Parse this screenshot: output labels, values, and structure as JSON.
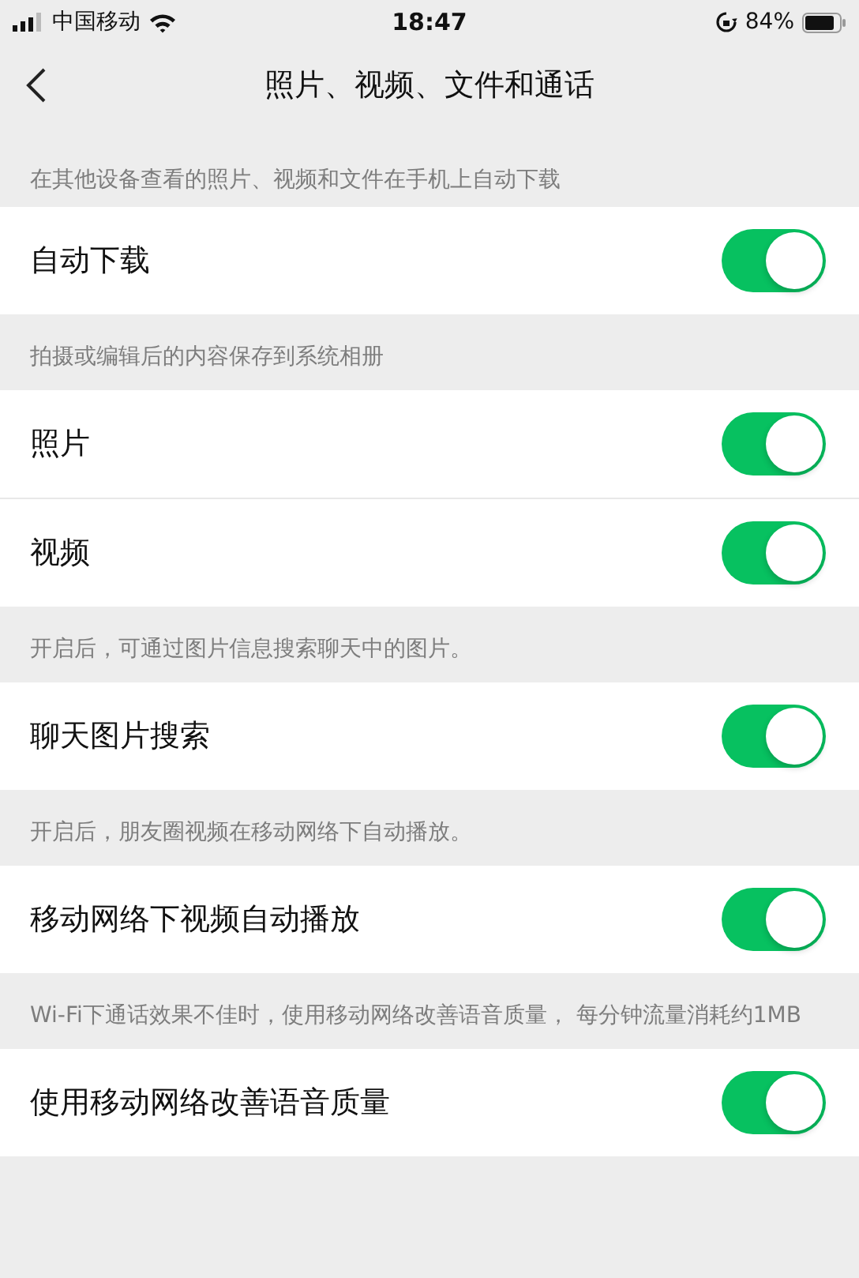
{
  "status_bar": {
    "carrier": "中国移动",
    "time": "18:47",
    "battery": "84%"
  },
  "nav": {
    "title": "照片、视频、文件和通话"
  },
  "sections": [
    {
      "hint": "在其他设备查看的照片、视频和文件在手机上自动下载",
      "rows": [
        {
          "label": "自动下载",
          "on": true
        }
      ]
    },
    {
      "hint": "拍摄或编辑后的内容保存到系统相册",
      "rows": [
        {
          "label": "照片",
          "on": true
        },
        {
          "label": "视频",
          "on": true
        }
      ]
    },
    {
      "hint": "开启后，可通过图片信息搜索聊天中的图片。",
      "rows": [
        {
          "label": "聊天图片搜索",
          "on": true
        }
      ]
    },
    {
      "hint": "开启后，朋友圈视频在移动网络下自动播放。",
      "rows": [
        {
          "label": "移动网络下视频自动播放",
          "on": true
        }
      ]
    },
    {
      "hint": "Wi-Fi下通话效果不佳时，使用移动网络改善语音质量， 每分钟流量消耗约1MB",
      "rows": [
        {
          "label": "使用移动网络改善语音质量",
          "on": true
        }
      ]
    }
  ]
}
